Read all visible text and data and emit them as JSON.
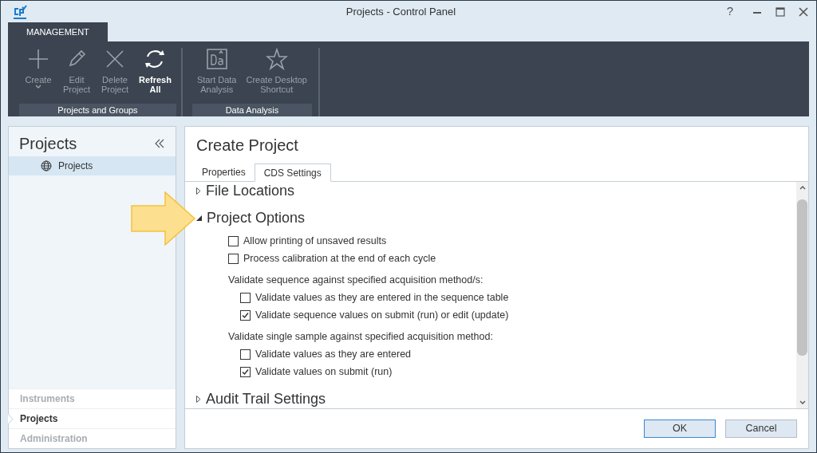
{
  "window": {
    "title": "Projects - Control Panel",
    "help": "?"
  },
  "ribbon": {
    "tabs": [
      {
        "label": "MANAGEMENT",
        "selected": true
      }
    ],
    "groups": [
      {
        "label": "Projects and Groups",
        "buttons": [
          {
            "kind": "create",
            "label": "Create",
            "disabled": true,
            "dropdown": true
          },
          {
            "kind": "edit",
            "label": "Edit\nProject",
            "disabled": true,
            "dropdown": false
          },
          {
            "kind": "delete",
            "label": "Delete\nProject",
            "disabled": true,
            "dropdown": false
          },
          {
            "kind": "refresh",
            "label": "Refresh\nAll",
            "disabled": false,
            "dropdown": false
          }
        ]
      },
      {
        "label": "Data Analysis",
        "buttons": [
          {
            "kind": "analysis",
            "label": "Start Data\nAnalysis",
            "disabled": true,
            "dropdown": false
          },
          {
            "kind": "star",
            "label": "Create Desktop\nShortcut",
            "disabled": true,
            "dropdown": false
          }
        ]
      }
    ]
  },
  "sidebar": {
    "title": "Projects",
    "tree": [
      {
        "label": "Projects",
        "selected": true
      }
    ],
    "nav": [
      {
        "label": "Instruments",
        "selected": false
      },
      {
        "label": "Projects",
        "selected": true
      },
      {
        "label": "Administration",
        "selected": false
      }
    ]
  },
  "main": {
    "title": "Create Project",
    "tabs": [
      {
        "label": "Properties",
        "selected": false
      },
      {
        "label": "CDS Settings",
        "selected": true
      }
    ],
    "sections": [
      {
        "title": "File Locations",
        "expanded": false
      },
      {
        "title": "Project Options",
        "expanded": true,
        "items": [
          {
            "kind": "checkbox",
            "label": "Allow printing of unsaved results",
            "checked": false
          },
          {
            "kind": "checkbox",
            "label": "Process calibration at the end of each cycle",
            "checked": false
          },
          {
            "kind": "group",
            "label": "Validate sequence against specified acquisition method/s:",
            "children": [
              {
                "kind": "checkbox",
                "label": "Validate values as they are entered in the sequence table",
                "checked": false
              },
              {
                "kind": "checkbox",
                "label": "Validate sequence values on submit (run) or edit (update)",
                "checked": true
              }
            ]
          },
          {
            "kind": "group",
            "label": "Validate single sample against specified acquisition method:",
            "children": [
              {
                "kind": "checkbox",
                "label": "Validate values as they are entered",
                "checked": false
              },
              {
                "kind": "checkbox",
                "label": "Validate values on submit (run)",
                "checked": true
              }
            ]
          }
        ]
      },
      {
        "title": "Audit Trail Settings",
        "expanded": false
      }
    ],
    "buttons": [
      {
        "label": "OK",
        "default": true
      },
      {
        "label": "Cancel",
        "default": false
      }
    ]
  }
}
